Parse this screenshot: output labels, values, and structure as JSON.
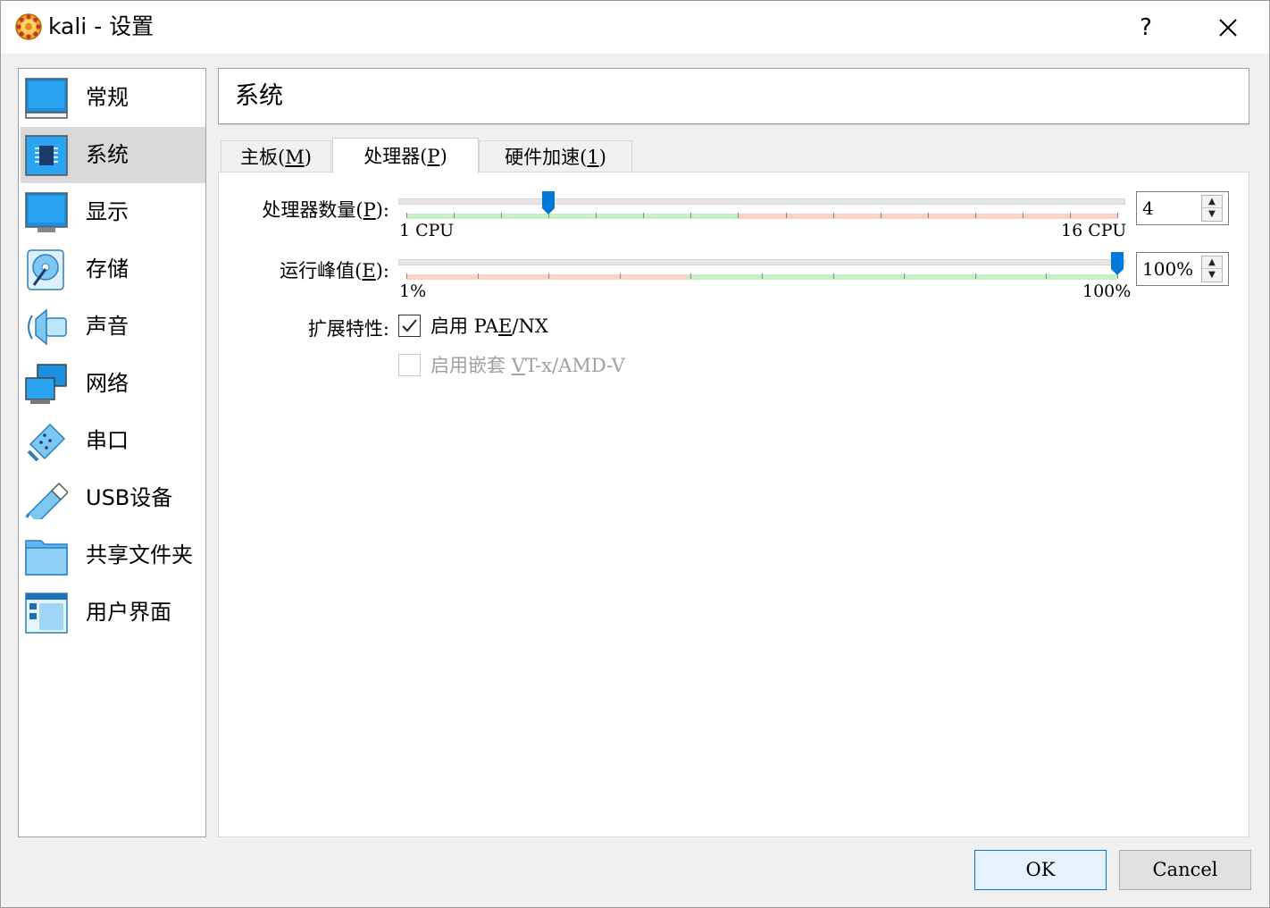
{
  "window": {
    "title": "kali - 设置",
    "help": "?",
    "close": "✕"
  },
  "sidebar": {
    "items": [
      {
        "label": "常规",
        "icon": "general-monitor-icon",
        "selected": false
      },
      {
        "label": "系统",
        "icon": "system-chip-icon",
        "selected": true
      },
      {
        "label": "显示",
        "icon": "display-monitor-icon",
        "selected": false
      },
      {
        "label": "存储",
        "icon": "storage-disk-icon",
        "selected": false
      },
      {
        "label": "声音",
        "icon": "audio-speaker-icon",
        "selected": false
      },
      {
        "label": "网络",
        "icon": "network-icon",
        "selected": false
      },
      {
        "label": "串口",
        "icon": "serial-port-icon",
        "selected": false
      },
      {
        "label": "USB设备",
        "icon": "usb-icon",
        "selected": false
      },
      {
        "label": "共享文件夹",
        "icon": "shared-folder-icon",
        "selected": false
      },
      {
        "label": "用户界面",
        "icon": "user-interface-icon",
        "selected": false
      }
    ]
  },
  "page": {
    "title": "系统"
  },
  "tabs": [
    {
      "pre": "主板(",
      "mnemonic": "M",
      "post": ")",
      "active": false
    },
    {
      "pre": "处理器(",
      "mnemonic": "P",
      "post": ")",
      "active": true
    },
    {
      "pre": "硬件加速(",
      "mnemonic": "1",
      "post": ")",
      "active": false
    }
  ],
  "processor": {
    "cpu_count": {
      "label_pre": "处理器数量(",
      "label_mn": "P",
      "label_post": "):",
      "min_label": "1 CPU",
      "max_label": "16 CPU",
      "min": 1,
      "max": 16,
      "value": 4,
      "value_text": "4",
      "recommended_max": 8
    },
    "exec_cap": {
      "label_pre": "运行峰值(",
      "label_mn": "E",
      "label_post": "):",
      "min_label": "1%",
      "max_label": "100%",
      "min": 1,
      "max": 100,
      "value": 100,
      "value_text": "100%",
      "recommended_min": 40
    },
    "ext_features": {
      "label": "扩展特性:",
      "pae": {
        "pre": "启用 PA",
        "mn": "E",
        "post": "/NX",
        "checked": true,
        "enabled": true
      },
      "nested": {
        "pre": "启用嵌套 ",
        "mn": "V",
        "post": "T-x/AMD-V",
        "checked": false,
        "enabled": false
      }
    }
  },
  "buttons": {
    "ok": "OK",
    "cancel": "Cancel"
  },
  "colors": {
    "accent": "#0078d7",
    "green_band": "#c4f0c4",
    "red_band": "#f9d3c3",
    "selected_nav": "#d9d9d9"
  }
}
